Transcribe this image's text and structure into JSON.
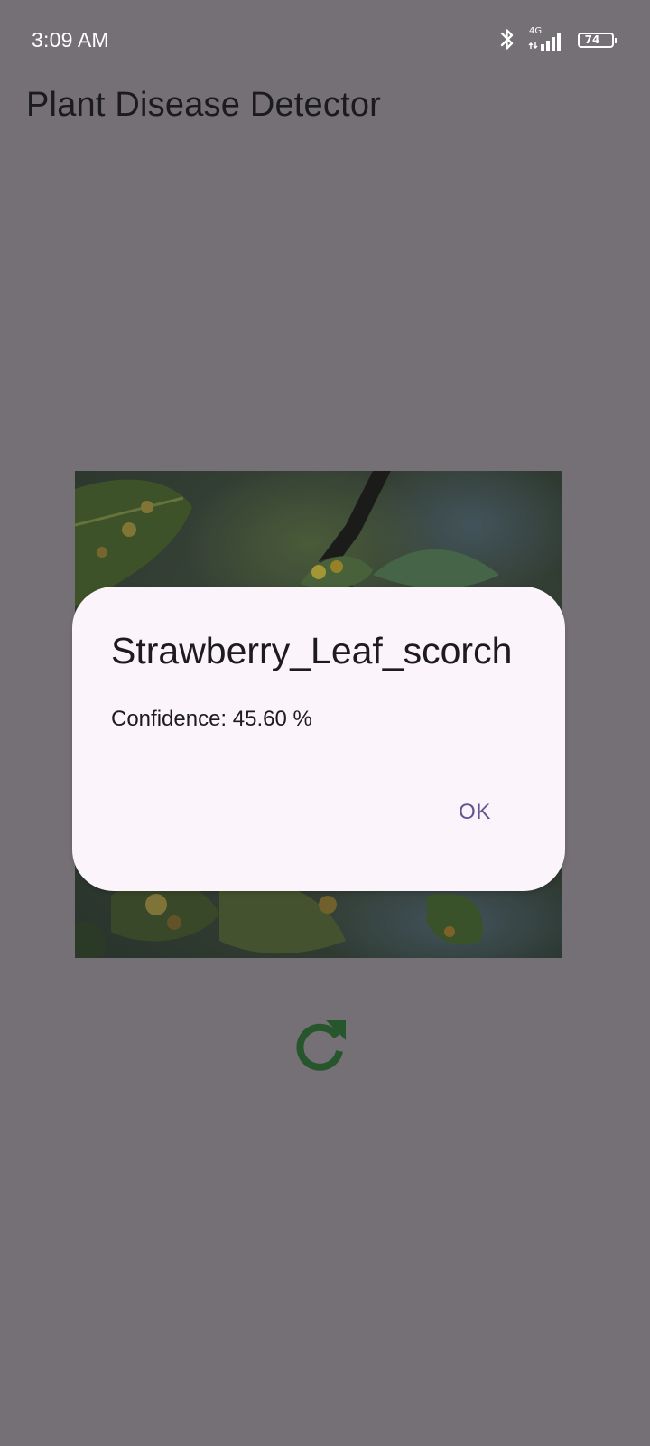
{
  "status_bar": {
    "time": "3:09 AM",
    "network_type": "4G",
    "battery_level": "74",
    "icons": [
      "bluetooth-icon",
      "signal-icon",
      "battery-icon"
    ]
  },
  "app_bar": {
    "title": "Plant Disease Detector"
  },
  "image": {
    "description_icon": "leaf-photo"
  },
  "refresh": {
    "icon": "refresh-icon",
    "color": "#27562c"
  },
  "dialog": {
    "title": "Strawberry_Leaf_scorch",
    "confidence_label": "Confidence: 45.60 %",
    "ok_label": "OK"
  },
  "colors": {
    "scrim_background": "#757075",
    "dialog_background": "#fbf4fb",
    "accent": "#64558f"
  }
}
